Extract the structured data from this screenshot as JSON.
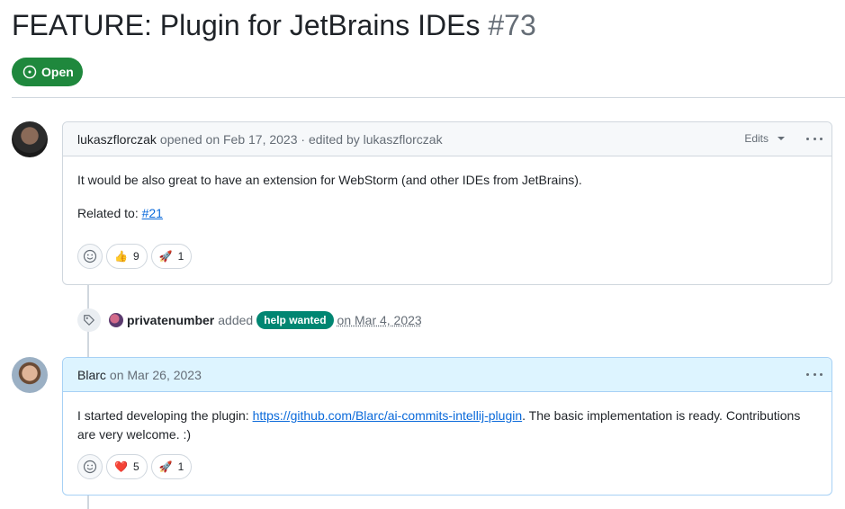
{
  "issue": {
    "title": "FEATURE: Plugin for JetBrains IDEs",
    "number": "#73",
    "state": "Open"
  },
  "comment1": {
    "author": "lukaszflorczak",
    "meta": "opened on Feb 17, 2023 · edited by lukaszflorczak",
    "edits_label": "Edits",
    "body_line1": "It would be also great to have an extension for WebStorm (and other IDEs from JetBrains).",
    "related_prefix": "Related to: ",
    "related_link": "#21",
    "reactions": [
      {
        "emoji": "👍",
        "count": "9"
      },
      {
        "emoji": "🚀",
        "count": "1"
      }
    ]
  },
  "event": {
    "actor": "privatenumber",
    "action": "added",
    "label": "help wanted",
    "date": "on Mar 4, 2023"
  },
  "comment2": {
    "author": "Blarc",
    "meta": "on Mar 26, 2023",
    "body_prefix": "I started developing the plugin: ",
    "body_link": "https://github.com/Blarc/ai-commits-intellij-plugin",
    "body_suffix": ". The basic implementation is ready. Contributions are very welcome. :)",
    "reactions": [
      {
        "emoji": "❤️",
        "count": "5"
      },
      {
        "emoji": "🚀",
        "count": "1"
      }
    ]
  },
  "colors": {
    "open_green": "#1f883d",
    "label_teal": "#008672",
    "link_blue": "#0969da"
  }
}
